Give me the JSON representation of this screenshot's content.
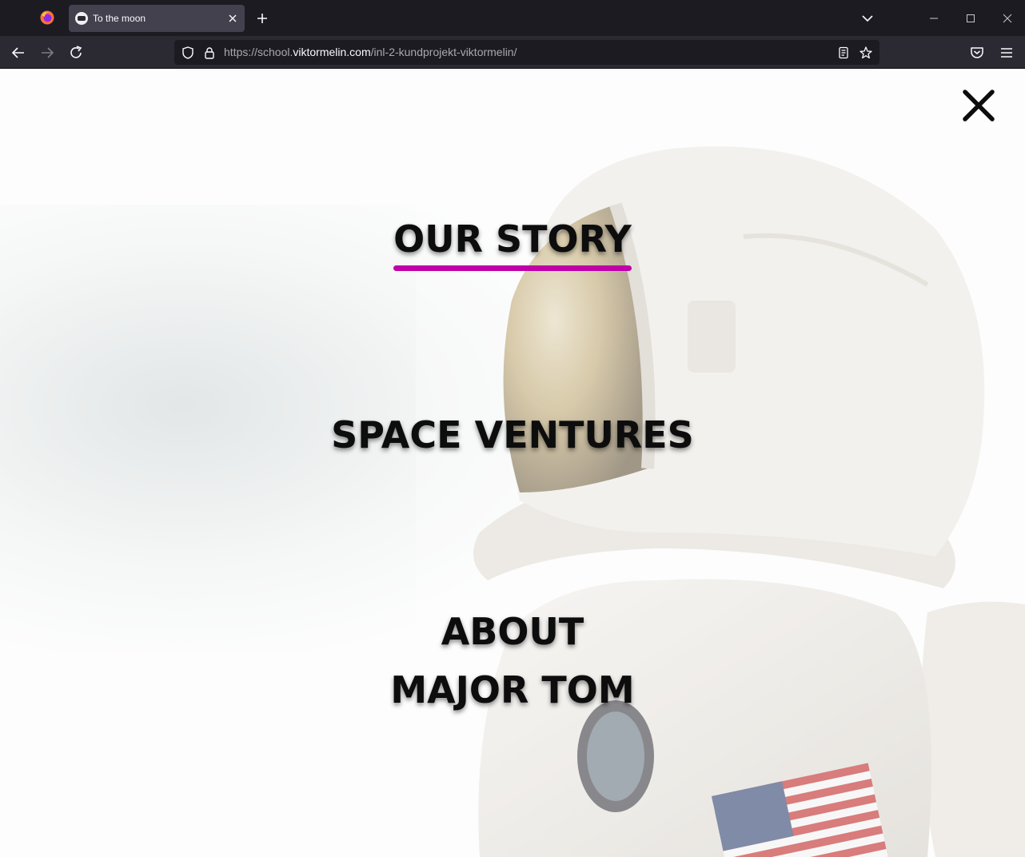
{
  "browser": {
    "tab_title": "To the moon",
    "url": {
      "prefix": "https://school.",
      "domain": "viktormelin.com",
      "path": "/inl-2-kundprojekt-viktormelin/"
    }
  },
  "menu": {
    "items": [
      {
        "label": "OUR STORY",
        "active": true
      },
      {
        "label": "SPACE VENTURES",
        "active": false
      },
      {
        "label": "ABOUT",
        "active": false
      },
      {
        "label": "MAJOR TOM",
        "active": false
      }
    ],
    "accent_color": "#c000a8"
  },
  "icons": {
    "close_menu": "close-icon",
    "browser": [
      "firefox-logo",
      "tab-favicon",
      "tab-close-icon",
      "new-tab-icon",
      "tab-list-icon",
      "minimize-icon",
      "maximize-icon",
      "window-close-icon",
      "back-icon",
      "forward-icon",
      "reload-icon",
      "shield-icon",
      "lock-icon",
      "reader-view-icon",
      "bookmark-star-icon",
      "pocket-icon",
      "hamburger-menu-icon"
    ]
  }
}
